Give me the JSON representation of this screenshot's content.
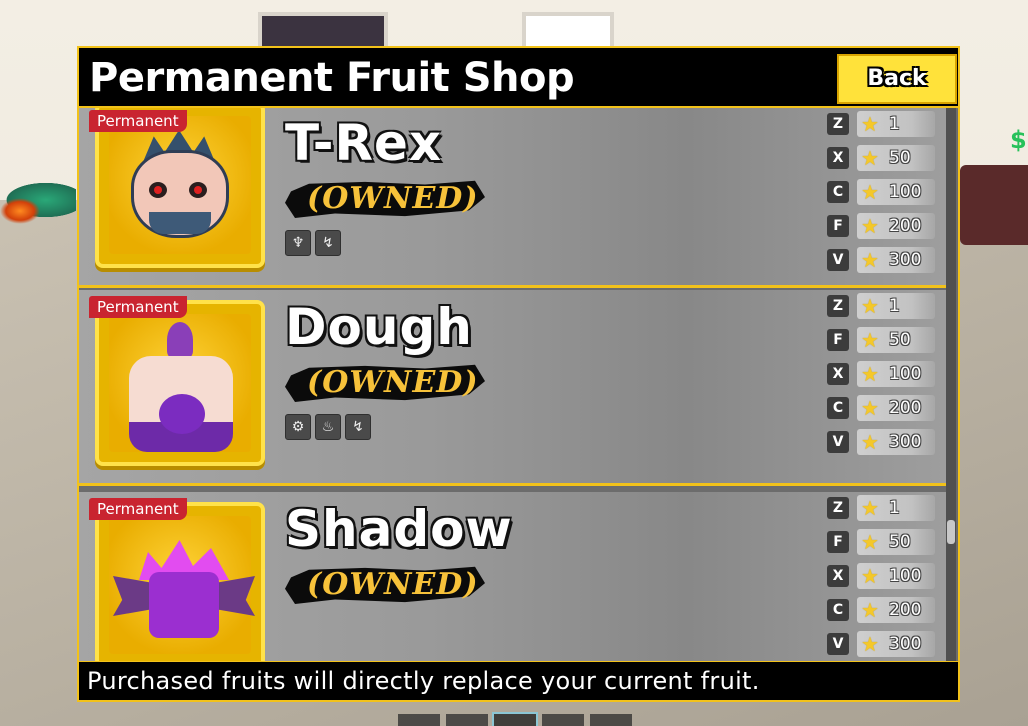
{
  "header": {
    "title": "Permanent Fruit Shop",
    "back_label": "Back"
  },
  "fruits": [
    {
      "badge": "Permanent",
      "name": "T-Rex",
      "status": "(OWNED)",
      "abilities": [
        "dragon-claw-icon",
        "swirl-icon"
      ],
      "moves": [
        {
          "key": "Z",
          "mastery": "1"
        },
        {
          "key": "X",
          "mastery": "50"
        },
        {
          "key": "C",
          "mastery": "100"
        },
        {
          "key": "F",
          "mastery": "200"
        },
        {
          "key": "V",
          "mastery": "300"
        }
      ]
    },
    {
      "badge": "Permanent",
      "name": "Dough",
      "status": "(OWNED)",
      "abilities": [
        "gear-icon",
        "fire-icon",
        "swirl-icon"
      ],
      "moves": [
        {
          "key": "Z",
          "mastery": "1"
        },
        {
          "key": "F",
          "mastery": "50"
        },
        {
          "key": "X",
          "mastery": "100"
        },
        {
          "key": "C",
          "mastery": "200"
        },
        {
          "key": "V",
          "mastery": "300"
        }
      ]
    },
    {
      "badge": "Permanent",
      "name": "Shadow",
      "status": "(OWNED)",
      "abilities": [],
      "moves": [
        {
          "key": "Z",
          "mastery": "1"
        },
        {
          "key": "F",
          "mastery": "50"
        },
        {
          "key": "X",
          "mastery": "100"
        },
        {
          "key": "C",
          "mastery": "200"
        },
        {
          "key": "V",
          "mastery": "300"
        }
      ]
    }
  ],
  "footer": {
    "note": "Purchased fruits will directly replace your current fruit."
  },
  "colors": {
    "accent": "#f2c21a",
    "badge": "#c92430",
    "owned_text": "#f7c23a",
    "back_button": "#ffe23a"
  }
}
